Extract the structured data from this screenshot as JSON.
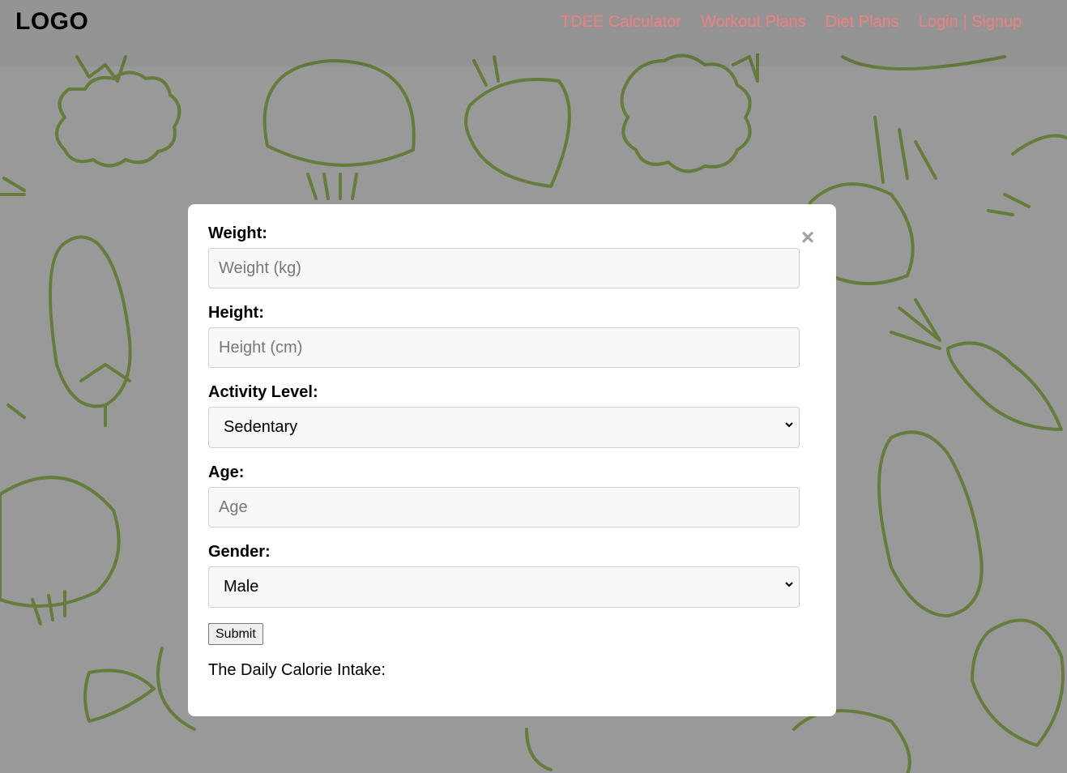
{
  "nav": {
    "logo": "LOGO",
    "links": [
      "TDEE Calculator",
      "Workout Plans",
      "Diet Plans",
      "Login | Signup"
    ]
  },
  "form": {
    "close_icon": "close-icon",
    "weight": {
      "label": "Weight:",
      "placeholder": "Weight (kg)"
    },
    "height": {
      "label": "Height:",
      "placeholder": "Height (cm)"
    },
    "activity": {
      "label": "Activity Level:",
      "selected": "Sedentary"
    },
    "age": {
      "label": "Age:",
      "placeholder": "Age"
    },
    "gender": {
      "label": "Gender:",
      "selected": "Male"
    },
    "submit_label": "Submit",
    "result_text": "The Daily Calorie Intake:"
  },
  "colors": {
    "nav_link": "#f08080",
    "pattern_stroke": "#a8cf65",
    "backdrop_overlay": "rgba(0,0,0,0.40)"
  }
}
